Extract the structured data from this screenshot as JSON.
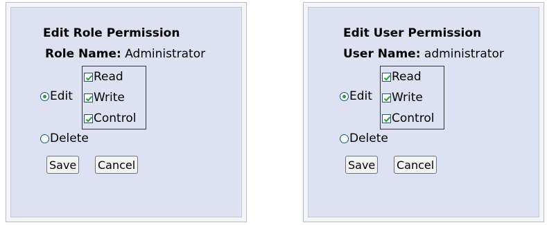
{
  "role_panel": {
    "title": "Edit Role Permission",
    "name_label": "Role Name:",
    "name_value": "Administrator",
    "permissions": [
      {
        "label": "Read",
        "checked": true
      },
      {
        "label": "Write",
        "checked": true
      },
      {
        "label": "Control",
        "checked": true
      }
    ],
    "edit_option": "Edit",
    "delete_option": "Delete",
    "selected_option": "Edit",
    "save_label": "Save",
    "cancel_label": "Cancel"
  },
  "user_panel": {
    "title": "Edit User Permission",
    "name_label": "User Name:",
    "name_value": "administrator",
    "permissions": [
      {
        "label": "Read",
        "checked": true
      },
      {
        "label": "Write",
        "checked": true
      },
      {
        "label": "Control",
        "checked": true
      }
    ],
    "edit_option": "Edit",
    "delete_option": "Delete",
    "selected_option": "Edit",
    "save_label": "Save",
    "cancel_label": "Cancel"
  },
  "colors": {
    "panel_background": "#dde2f2",
    "check_mark": "#2e9a33",
    "control_border": "#1e4f8f"
  }
}
